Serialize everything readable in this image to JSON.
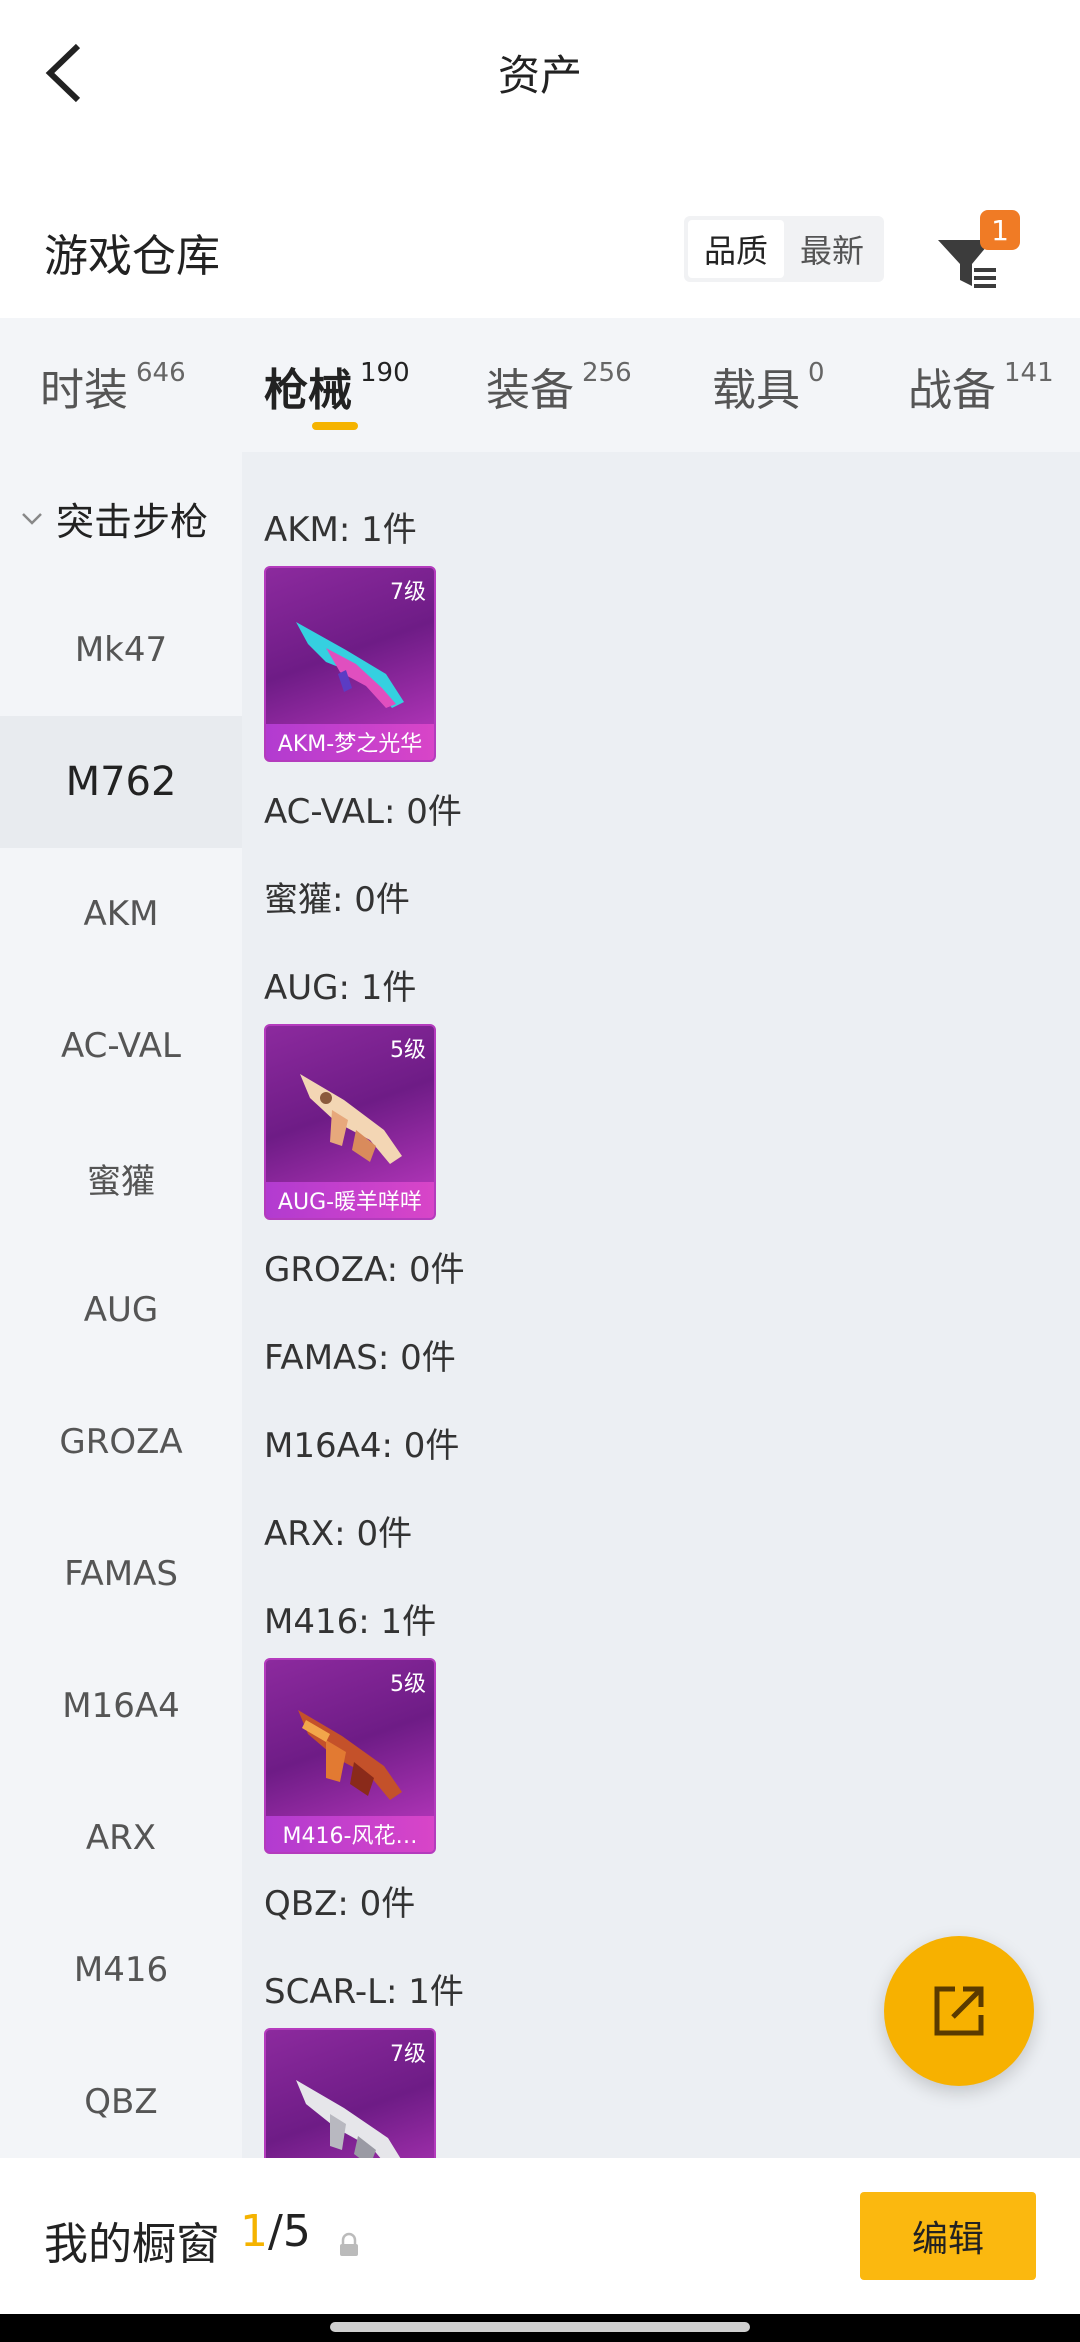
{
  "topbar": {
    "title": "资产"
  },
  "warehouse": {
    "title": "游戏仓库",
    "sort_options": [
      {
        "label": "品质",
        "active": true
      },
      {
        "label": "最新",
        "active": false
      }
    ],
    "filter_badge": "1"
  },
  "tabs": [
    {
      "label": "时装",
      "count": "646"
    },
    {
      "label": "枪械",
      "count": "190",
      "active": true
    },
    {
      "label": "装备",
      "count": "256"
    },
    {
      "label": "载具",
      "count": "0"
    },
    {
      "label": "战备",
      "count": "141"
    }
  ],
  "sidebar": {
    "group": "突击步枪",
    "items": [
      "Mk47",
      "M762",
      "AKM",
      "AC-VAL",
      "蜜獾",
      "AUG",
      "GROZA",
      "FAMAS",
      "M16A4",
      "ARX",
      "M416",
      "QBZ"
    ],
    "active_item": "M762"
  },
  "content": {
    "weapons": [
      {
        "label": "AKM: 1件",
        "skin": {
          "level": "7级",
          "name": "AKM-梦之光华"
        }
      },
      {
        "label": "AC-VAL: 0件"
      },
      {
        "label": "蜜獾: 0件"
      },
      {
        "label": "AUG: 1件",
        "skin": {
          "level": "5级",
          "name": "AUG-暖羊咩咩"
        }
      },
      {
        "label": "GROZA: 0件"
      },
      {
        "label": "FAMAS: 0件"
      },
      {
        "label": "M16A4: 0件"
      },
      {
        "label": "ARX: 0件"
      },
      {
        "label": "M416: 1件",
        "skin": {
          "level": "5级",
          "name": "M416-风花…"
        }
      },
      {
        "label": "QBZ: 0件"
      },
      {
        "label": "SCAR-L: 1件",
        "skin": {
          "level": "7级",
          "name": ""
        }
      }
    ]
  },
  "bottombar": {
    "label": "我的橱窗",
    "current": "1",
    "total": "/5",
    "edit_label": "编辑"
  },
  "colors": {
    "accent": "#f5b300",
    "badge": "#f07b25",
    "skin_purple": "#8c2a9e"
  }
}
